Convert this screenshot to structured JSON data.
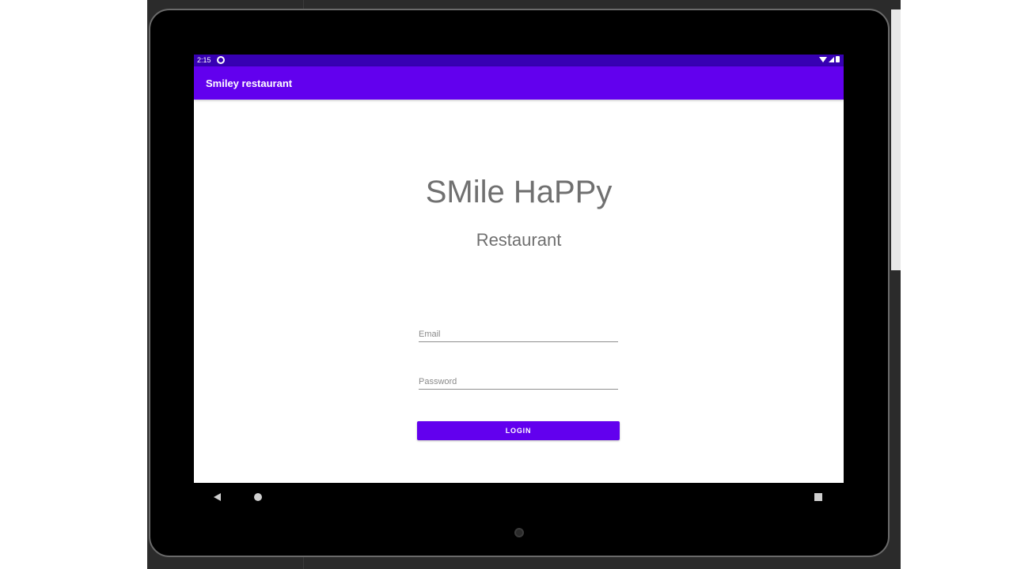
{
  "status_bar": {
    "time": "2:15"
  },
  "app_bar": {
    "title": "Smiley restaurant"
  },
  "content": {
    "headline": "SMile HaPPy",
    "subheadline": "Restaurant"
  },
  "form": {
    "email_placeholder": "Email",
    "password_placeholder": "Password",
    "login_label": "LOGIN"
  },
  "navigation": {
    "back_icon": "back-triangle-icon",
    "home_icon": "home-circle-icon",
    "recents_icon": "recents-square-icon"
  },
  "colors": {
    "primary": "#6200ee",
    "primary_dark": "#3700b3",
    "text_gray": "#707070"
  }
}
